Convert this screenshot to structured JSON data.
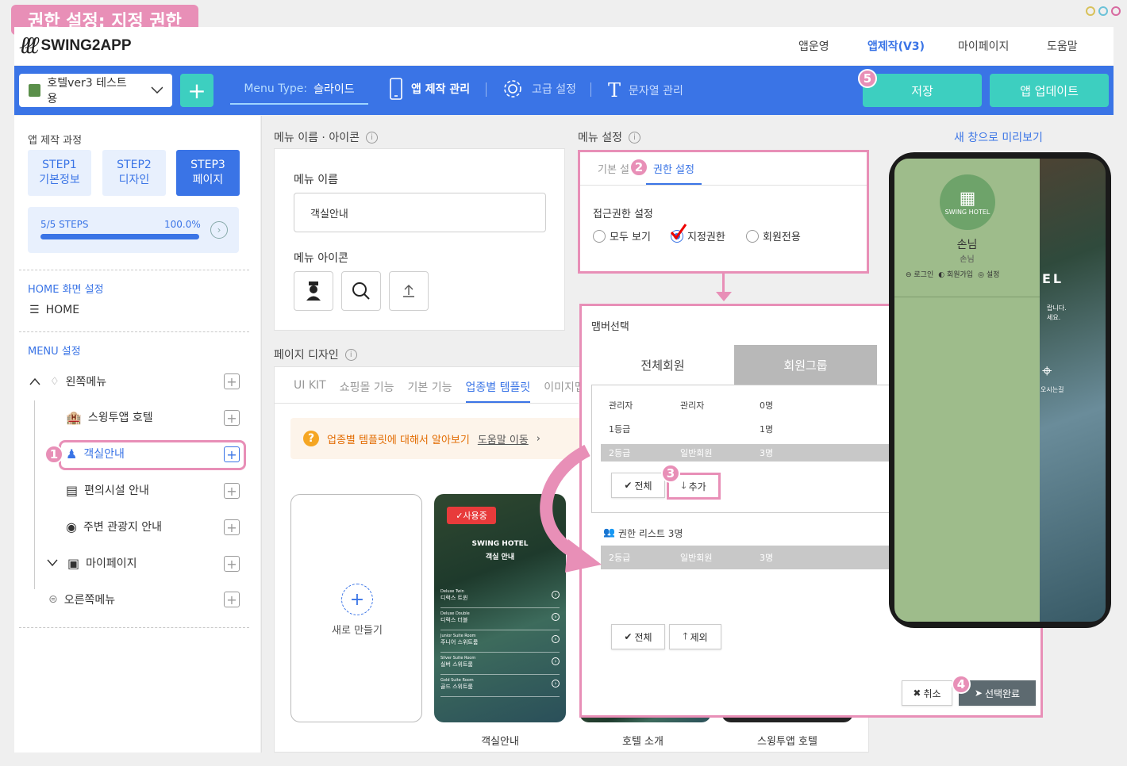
{
  "banner": {
    "title": "권한 설정: 지정 권한"
  },
  "header": {
    "logo_text": "SWING2APP",
    "nav": [
      "앱운영",
      "앱제작(V3)",
      "마이페이지",
      "도움말"
    ]
  },
  "toolbar": {
    "app_name": "호텔ver3 테스트용",
    "plus": "+",
    "menu_type_label": "Menu Type:",
    "menu_type_value": "슬라이드",
    "app_manage": "앱 제작 관리",
    "advanced": "고급 설정",
    "strings": "문자열 관리",
    "save": "저장",
    "update": "앱 업데이트"
  },
  "sidebar": {
    "process_title": "앱 제작 과정",
    "steps": [
      {
        "line1": "STEP1",
        "line2": "기본정보"
      },
      {
        "line1": "STEP2",
        "line2": "디자인"
      },
      {
        "line1": "STEP3",
        "line2": "페이지"
      }
    ],
    "steps_count": "5/5 STEPS",
    "steps_percent": "100.0%",
    "progress": 1.0,
    "home_section": "HOME 화면 설정",
    "home_item": "HOME",
    "menu_section": "MENU 설정",
    "left_menu": "왼쪽메뉴",
    "items": [
      "스윙투앱 호텔",
      "객실안내",
      "편의시설 안내",
      "주변 관광지 안내",
      "마이페이지"
    ],
    "right_menu": "오른쪽메뉴"
  },
  "menu_panel": {
    "title": "메뉴 이름 · 아이콘",
    "name_label": "메뉴 이름",
    "name_value": "객실안내",
    "icon_label": "메뉴 아이콘"
  },
  "design_panel": {
    "title": "페이지 디자인",
    "tabs": [
      "UI KIT",
      "쇼핑몰 기능",
      "기본 기능",
      "업종별 템플릿",
      "이미지맵"
    ],
    "help_text": "업종별 템플릿에 대해서 알아보기",
    "help_link": "도움말 이동",
    "new_label": "새로 만들기",
    "in_use": "사용중",
    "tpl_title1": "SWING HOTEL",
    "tpl_title2": "객실 안내",
    "tpl_rooms": [
      {
        "en": "Deluxe Twin",
        "ko": "디럭스 트윈"
      },
      {
        "en": "Deluxe Double",
        "ko": "디럭스 더블"
      },
      {
        "en": "Junior Suite Room",
        "ko": "주니어 스위트룸"
      },
      {
        "en": "Silver Suite Room",
        "ko": "실버 스위트룸"
      },
      {
        "en": "Gold Suite Room",
        "ko": "골드 스위트룸"
      }
    ],
    "captions": [
      "객실안내",
      "호텔 소개",
      "스윙투앱 호텔"
    ]
  },
  "settings_panel": {
    "title": "메뉴 설정",
    "tab_basic": "기본 설정",
    "tab_perm": "권한 설정",
    "access_label": "접근권한 설정",
    "options": [
      "모두 보기",
      "지정권한",
      "회원전용"
    ]
  },
  "modal": {
    "title": "맴버선택",
    "close": "×",
    "tab_all": "전체회원",
    "tab_group": "회원그룹",
    "rows": [
      {
        "a": "관리자",
        "b": "관리자",
        "c": "0명"
      },
      {
        "a": "1등급",
        "b": "",
        "c": "1명"
      },
      {
        "a": "2등급",
        "b": "일반회원",
        "c": "3명"
      }
    ],
    "btn_all": "전체",
    "btn_add": "추가",
    "list_title": "권한 리스트 3명",
    "list_rows": [
      {
        "a": "2등급",
        "b": "일반회원",
        "c": "3명"
      }
    ],
    "btn_all2": "전체",
    "btn_remove": "제외",
    "cancel": "취소",
    "confirm": "선택완료"
  },
  "preview": {
    "link": "새 창으로 미리보기",
    "hotel": "SWING HOTEL",
    "user": "손님",
    "user_sub": "손님",
    "login": "로그인",
    "join": "회원가입",
    "settings": "설정",
    "bg_text": "EL",
    "bg_note1": "랍니다.",
    "bg_note2": "세요.",
    "location": "오시는길"
  },
  "badges": [
    "1",
    "2",
    "3",
    "4",
    "5"
  ],
  "colors": {
    "accent": "#3a74e6",
    "teal": "#3dcfc0",
    "pink": "#e88fb7"
  }
}
